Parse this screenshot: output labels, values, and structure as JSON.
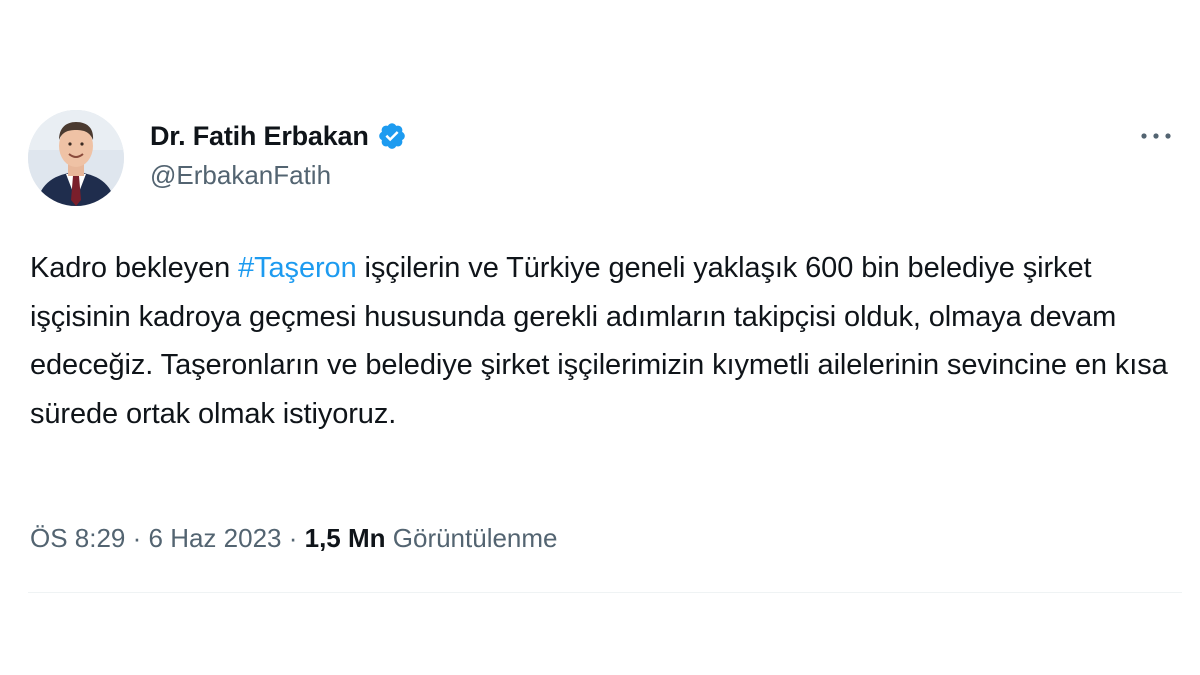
{
  "author": {
    "display_name": "Dr. Fatih Erbakan",
    "handle": "@ErbakanFatih",
    "verified": true,
    "verified_color": "#1d9bf0",
    "avatar_icon": "profile-photo"
  },
  "more_icon": "more-horizontal-icon",
  "tweet": {
    "text_before_hashtag": "Kadro bekleyen ",
    "hashtag": "#Taşeron",
    "text_after_hashtag": " işçilerin ve Türkiye geneli yaklaşık 600 bin belediye şirket işçisinin kadroya geçmesi hususunda gerekli adımların takipçisi olduk, olmaya devam edeceğiz. Taşeronların ve belediye şirket işçilerimizin kıymetli ailelerinin sevincine en kısa sürede ortak olmak istiyoruz."
  },
  "meta": {
    "time": "ÖS 8:29",
    "separator": " · ",
    "date": "6 Haz 2023",
    "separator2": " · ",
    "views_count": "1,5 Mn",
    "views_label": " Görüntülenme"
  },
  "colors": {
    "hashtag": "#1d9bf0",
    "secondary_text": "#536471",
    "primary_text": "#0f1419",
    "divider": "#eff3f4"
  }
}
